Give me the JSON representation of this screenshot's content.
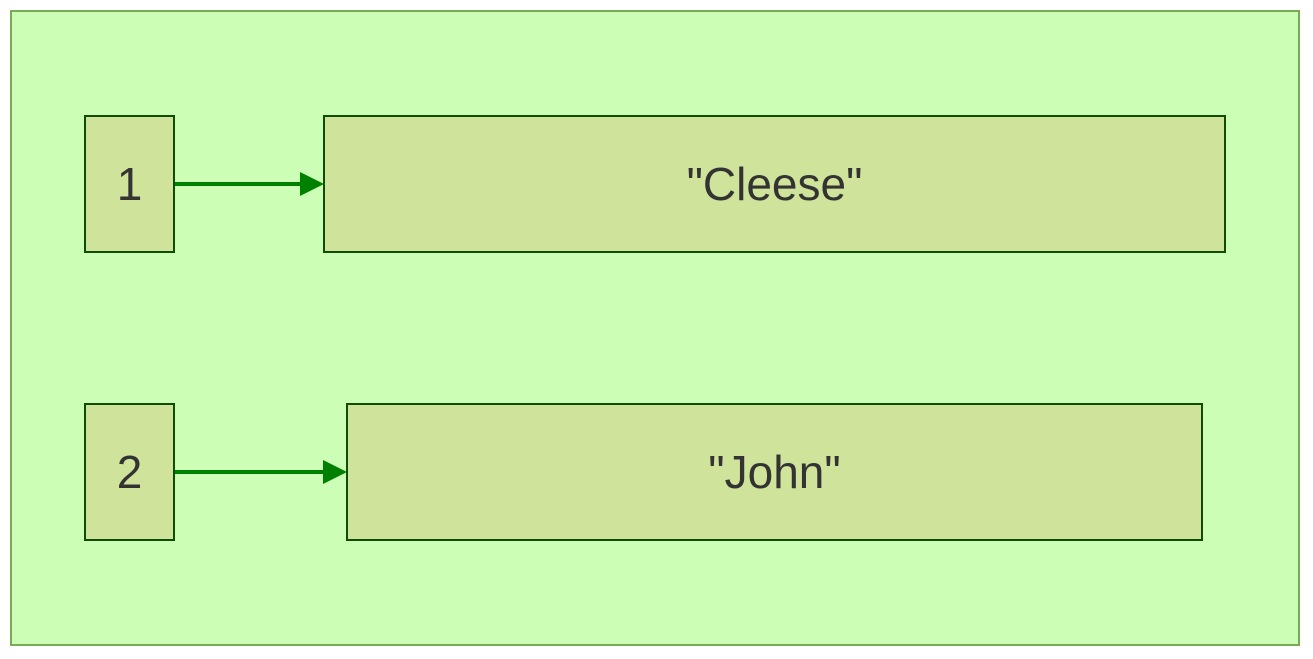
{
  "colors": {
    "background": "#ccffb5",
    "frame_border": "#78ab54",
    "box_fill": "#d0e39a",
    "box_border": "#0d4d07",
    "arrow": "#008000",
    "text": "#333333"
  },
  "entries": [
    {
      "key": "1",
      "value": "\"Cleese\""
    },
    {
      "key": "2",
      "value": "\"John\""
    }
  ]
}
